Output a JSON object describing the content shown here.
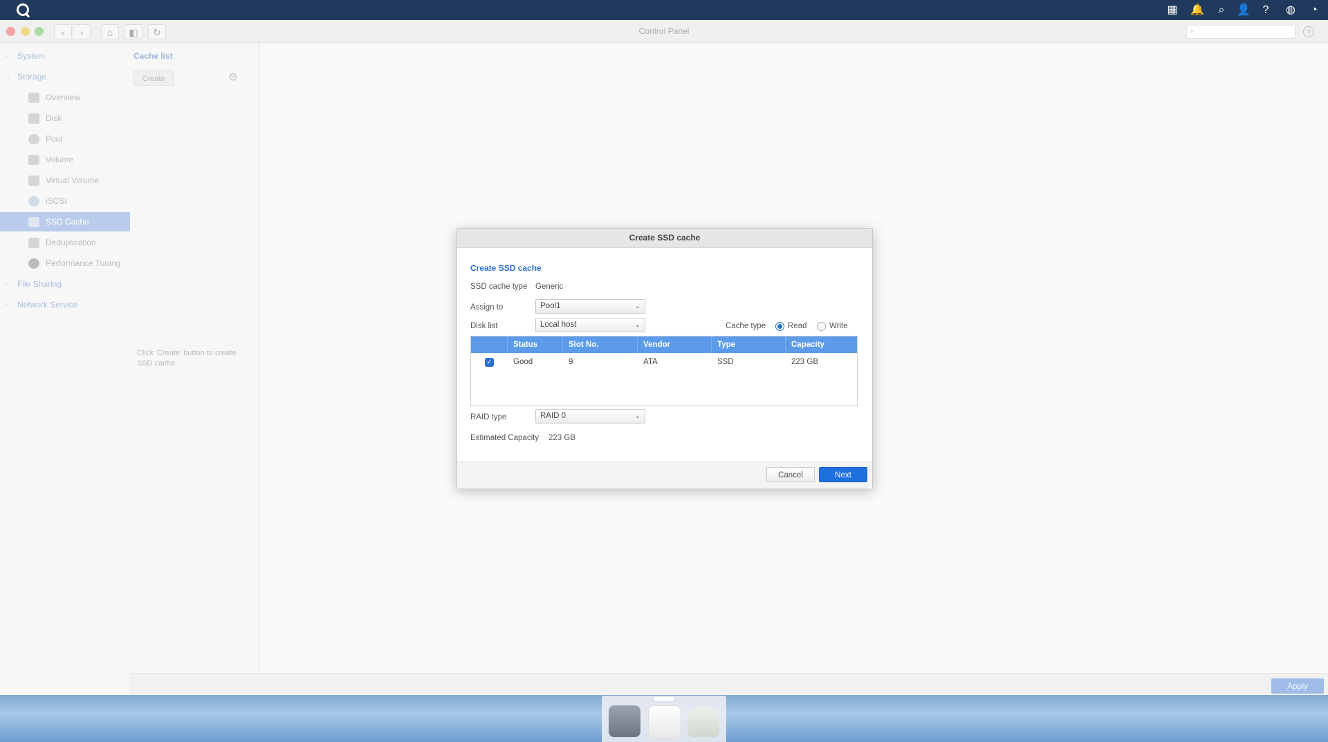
{
  "window": {
    "title": "Control Panel"
  },
  "sidebar": {
    "groups": [
      {
        "label": "System"
      },
      {
        "label": "Storage"
      },
      {
        "label": "File Sharing"
      },
      {
        "label": "Network Service"
      }
    ],
    "items": [
      {
        "label": "Overview",
        "icon": "overview-icon"
      },
      {
        "label": "Disk",
        "icon": "disk-icon"
      },
      {
        "label": "Pool",
        "icon": "pool-icon"
      },
      {
        "label": "Volume",
        "icon": "volume-icon"
      },
      {
        "label": "Virtual Volume",
        "icon": "virtual-volume-icon"
      },
      {
        "label": "iSCSI",
        "icon": "iscsi-icon"
      },
      {
        "label": "SSD Cache",
        "icon": "ssd-cache-icon",
        "active": true
      },
      {
        "label": "Deduplication",
        "icon": "deduplication-icon"
      },
      {
        "label": "Performance Tuning",
        "icon": "performance-tuning-icon"
      }
    ]
  },
  "cache_list": {
    "title": "Cache list",
    "create_label": "Create",
    "hint": "Click 'Create' button to create SSD cache."
  },
  "footer": {
    "apply_label": "Apply"
  },
  "dialog": {
    "title": "Create SSD cache",
    "subtitle": "Create SSD cache",
    "ssd_cache_type_label": "SSD cache type",
    "ssd_cache_type_value": "Generic",
    "assign_to_label": "Assign to",
    "assign_to_value": "Pool1",
    "disk_list_label": "Disk list",
    "disk_list_value": "Local host",
    "cache_type_label": "Cache type",
    "cache_type_options": [
      "Read",
      "Write"
    ],
    "cache_type_selected": "Read",
    "table": {
      "columns": [
        "Status",
        "Slot No.",
        "Vendor",
        "Type",
        "Capacity"
      ],
      "rows": [
        {
          "checked": true,
          "status": "Good",
          "slot": "9",
          "vendor": "ATA",
          "type": "SSD",
          "capacity": "223 GB"
        }
      ]
    },
    "raid_type_label": "RAID type",
    "raid_type_value": "RAID 0",
    "estimated_capacity_label": "Estimated Capacity",
    "estimated_capacity_value": "223 GB",
    "cancel_label": "Cancel",
    "next_label": "Next"
  },
  "colors": {
    "accent": "#2a6fd3",
    "table_header": "#5b9be9",
    "topbar": "#1f3a5c"
  }
}
